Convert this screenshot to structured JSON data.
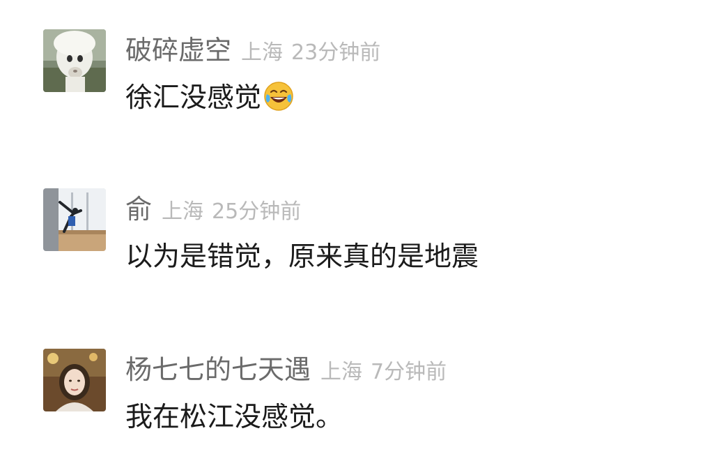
{
  "comments": [
    {
      "username": "破碎虚空",
      "location": "上海",
      "time": "23分钟前",
      "text": "徐汇没感觉",
      "emoji": "tears-of-joy-emoji"
    },
    {
      "username": "俞",
      "location": "上海",
      "time": "25分钟前",
      "text": "以为是错觉，原来真的是地震"
    },
    {
      "username": "杨七七的七天遇",
      "location": "上海",
      "time": "7分钟前",
      "text": "我在松江没感觉。"
    }
  ],
  "avatars": [
    "alpaca-avatar",
    "dancer-avatar",
    "woman-portrait-avatar"
  ]
}
